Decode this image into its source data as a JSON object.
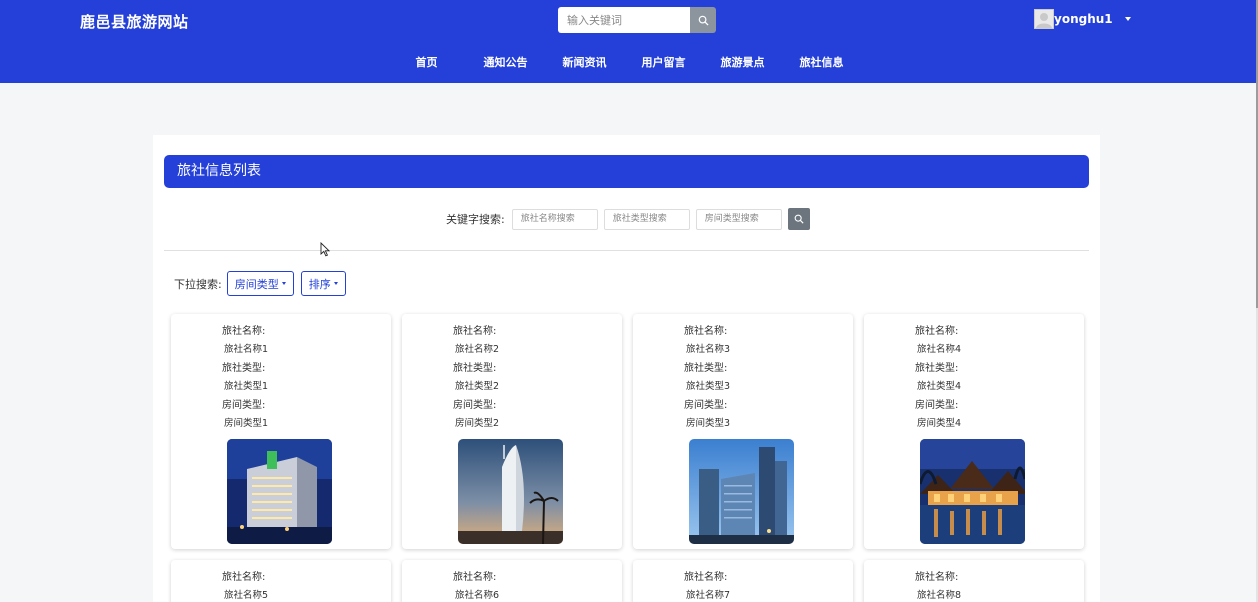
{
  "header": {
    "site_title": "鹿邑县旅游网站",
    "search_placeholder": "输入关键词",
    "username": "yonghu1",
    "nav": [
      "首页",
      "通知公告",
      "新闻资讯",
      "用户留言",
      "旅游景点",
      "旅社信息"
    ]
  },
  "main": {
    "title": "旅社信息列表",
    "keyword_label": "关键字搜索:",
    "keyword_placeholders": [
      "旅社名称搜索",
      "旅社类型搜索",
      "房间类型搜索"
    ],
    "dropdown_label": "下拉搜索:",
    "dropdowns": [
      "房间类型",
      "排序"
    ]
  },
  "cards": [
    {
      "name_label": "旅社名称:",
      "name": "旅社名称1",
      "type_label": "旅社类型:",
      "type": "旅社类型1",
      "room_label": "房间类型:",
      "room": "房间类型1"
    },
    {
      "name_label": "旅社名称:",
      "name": "旅社名称2",
      "type_label": "旅社类型:",
      "type": "旅社类型2",
      "room_label": "房间类型:",
      "room": "房间类型2"
    },
    {
      "name_label": "旅社名称:",
      "name": "旅社名称3",
      "type_label": "旅社类型:",
      "type": "旅社类型3",
      "room_label": "房间类型:",
      "room": "房间类型3"
    },
    {
      "name_label": "旅社名称:",
      "name": "旅社名称4",
      "type_label": "旅社类型:",
      "type": "旅社类型4",
      "room_label": "房间类型:",
      "room": "房间类型4"
    },
    {
      "name_label": "旅社名称:",
      "name": "旅社名称5"
    },
    {
      "name_label": "旅社名称:",
      "name": "旅社名称6"
    },
    {
      "name_label": "旅社名称:",
      "name": "旅社名称7"
    },
    {
      "name_label": "旅社名称:",
      "name": "旅社名称8"
    }
  ],
  "colors": {
    "brand": "#2440d8",
    "search_button": "#6c757d"
  },
  "icons": {
    "search": "search-icon",
    "user": "user-avatar-icon",
    "caret": "caret-down-icon"
  }
}
